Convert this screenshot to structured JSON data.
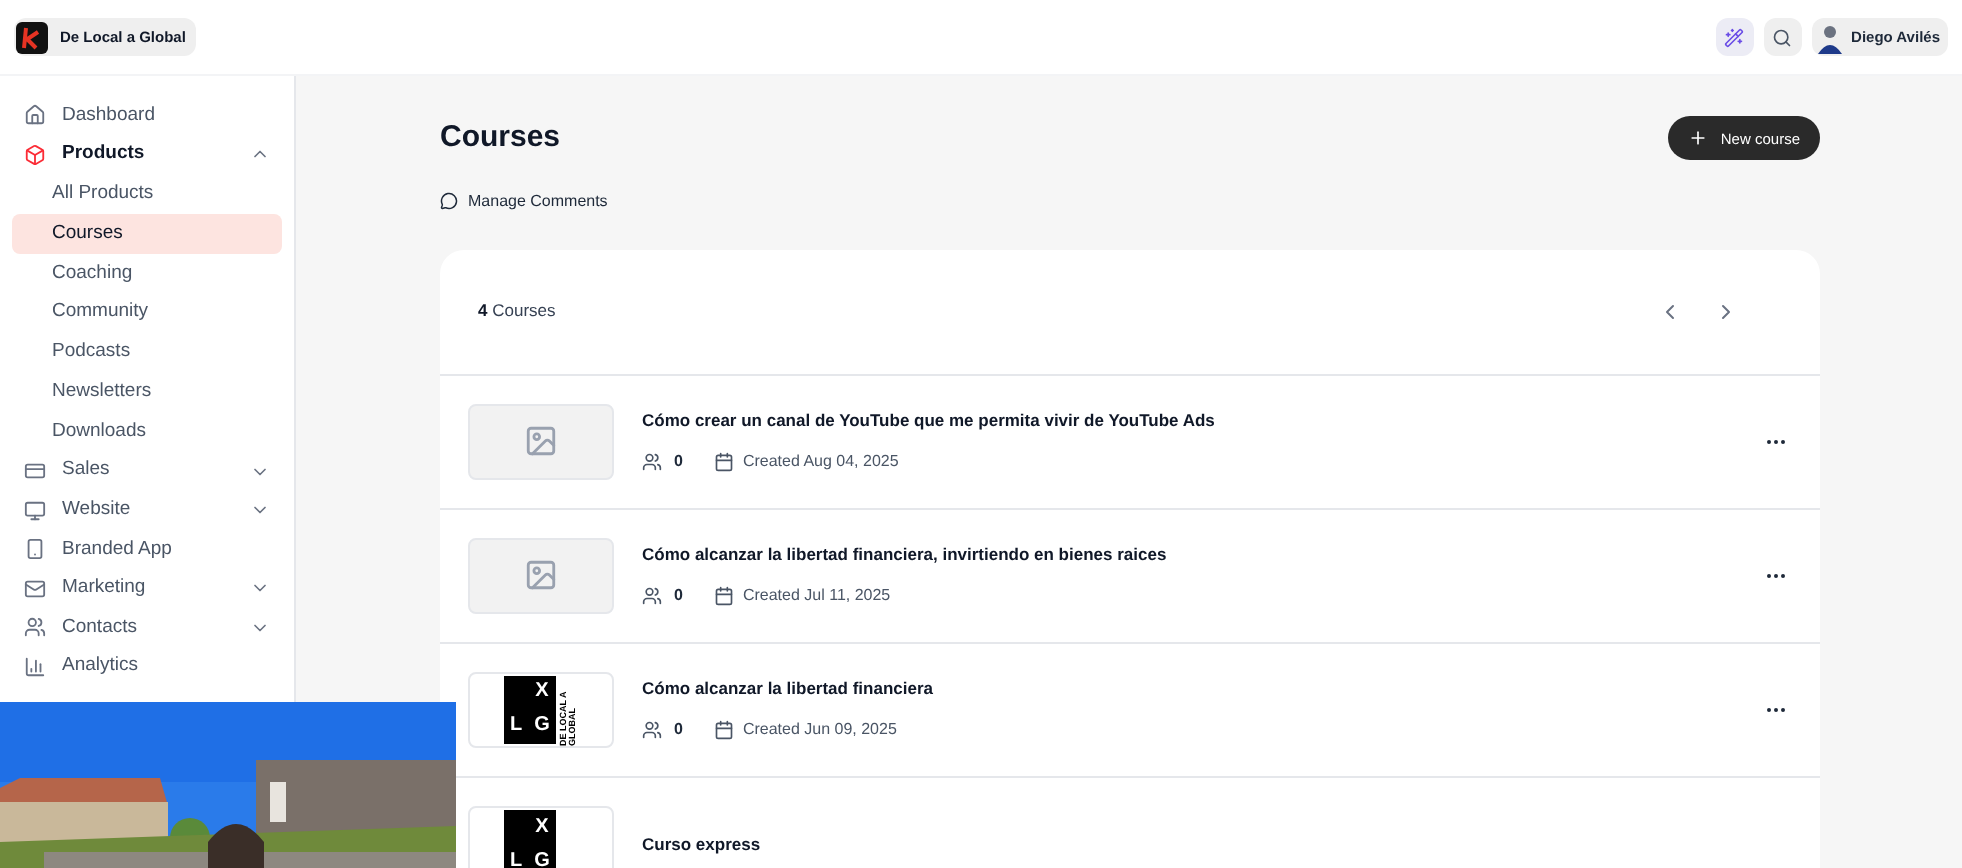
{
  "brand": {
    "name": "De Local a Global"
  },
  "topbar": {
    "user": "Diego Avilés"
  },
  "sidebar": {
    "items": [
      {
        "label": "Dashboard",
        "kind": "link",
        "selected": false
      },
      {
        "label": "Products",
        "kind": "group",
        "expanded": true,
        "selected": true,
        "children": [
          {
            "label": "All Products",
            "selected": false
          },
          {
            "label": "Courses",
            "selected": true
          },
          {
            "label": "Coaching",
            "selected": false
          },
          {
            "label": "Community",
            "selected": false
          },
          {
            "label": "Podcasts",
            "selected": false
          },
          {
            "label": "Newsletters",
            "selected": false
          },
          {
            "label": "Downloads",
            "selected": false
          }
        ]
      },
      {
        "label": "Sales",
        "kind": "group",
        "expanded": false,
        "selected": false
      },
      {
        "label": "Website",
        "kind": "group",
        "expanded": false,
        "selected": false
      },
      {
        "label": "Branded App",
        "kind": "link",
        "selected": false
      },
      {
        "label": "Marketing",
        "kind": "group",
        "expanded": false,
        "selected": false
      },
      {
        "label": "Contacts",
        "kind": "group",
        "expanded": false,
        "selected": false
      },
      {
        "label": "Analytics",
        "kind": "link",
        "selected": false
      }
    ]
  },
  "page": {
    "title": "Courses",
    "new_button": "New course",
    "manage_comments": "Manage Comments"
  },
  "list": {
    "count": "4",
    "count_label": "Courses",
    "rows": [
      {
        "title": "Cómo crear un canal de YouTube que me permita vivir de YouTube Ads",
        "thumbnail": {
          "kind": "placeholder"
        },
        "members": "0",
        "created": "Created Aug 04, 2025"
      },
      {
        "title": "Cómo alcanzar la libertad financiera, invirtiendo en bienes raices",
        "thumbnail": {
          "kind": "placeholder"
        },
        "members": "0",
        "created": "Created Jul 11, 2025"
      },
      {
        "title": "Cómo alcanzar la libertad financiera",
        "thumbnail": {
          "kind": "logo",
          "letters": [
            "X",
            "L",
            "G"
          ],
          "caption": "DE LOCAL A GLOBAL"
        },
        "members": "0",
        "created": "Created Jun 09, 2025"
      },
      {
        "title": "Curso express",
        "thumbnail": {
          "kind": "logo",
          "letters": [
            "X",
            "L",
            "G"
          ]
        }
      }
    ]
  }
}
